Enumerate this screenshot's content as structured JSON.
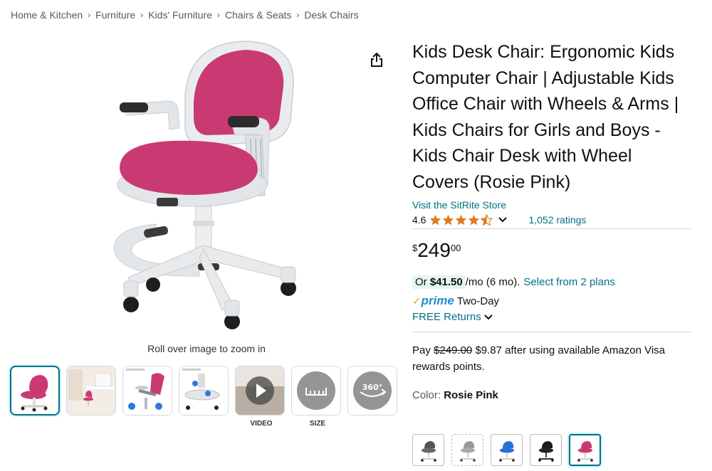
{
  "breadcrumb": [
    "Home & Kitchen",
    "Furniture",
    "Kids' Furniture",
    "Chairs & Seats",
    "Desk Chairs"
  ],
  "product": {
    "title": "Kids Desk Chair: Ergonomic Kids Computer Chair | Adjustable Kids Office Chair with Wheels & Arms | Kids Chairs for Girls and Boys - Kids Chair Desk with Wheel Covers (Rosie Pink)",
    "store_link": "Visit the SitRite Store",
    "rating": "4.6",
    "rating_value": 4.6,
    "ratings_count": "1,052 ratings"
  },
  "gallery": {
    "zoom_hint": "Roll over image to zoom in",
    "video_label": "VIDEO",
    "size_label": "SIZE",
    "badge_360": "360°"
  },
  "price": {
    "symbol": "$",
    "whole": "249",
    "fraction": "00"
  },
  "monthly": {
    "prefix": "Or",
    "amount": "$41.50",
    "suffix": "/mo (6 mo).",
    "plans_link": "Select from 2 plans"
  },
  "delivery": {
    "check": "✓",
    "prime": "prime",
    "speed": "Two-Day",
    "returns": "FREE Returns"
  },
  "rewards": {
    "pay": "Pay",
    "old_price": "$249.00",
    "new_text": "$9.87 after using available Amazon Visa rewards points."
  },
  "color": {
    "label": "Color:",
    "value": "Rosie Pink"
  },
  "colors": {
    "pink": "#c93a72",
    "teal_link": "#007185",
    "prime_blue": "#1f8ecf",
    "star_orange": "#de7921",
    "check_orange": "#f7a21d"
  }
}
